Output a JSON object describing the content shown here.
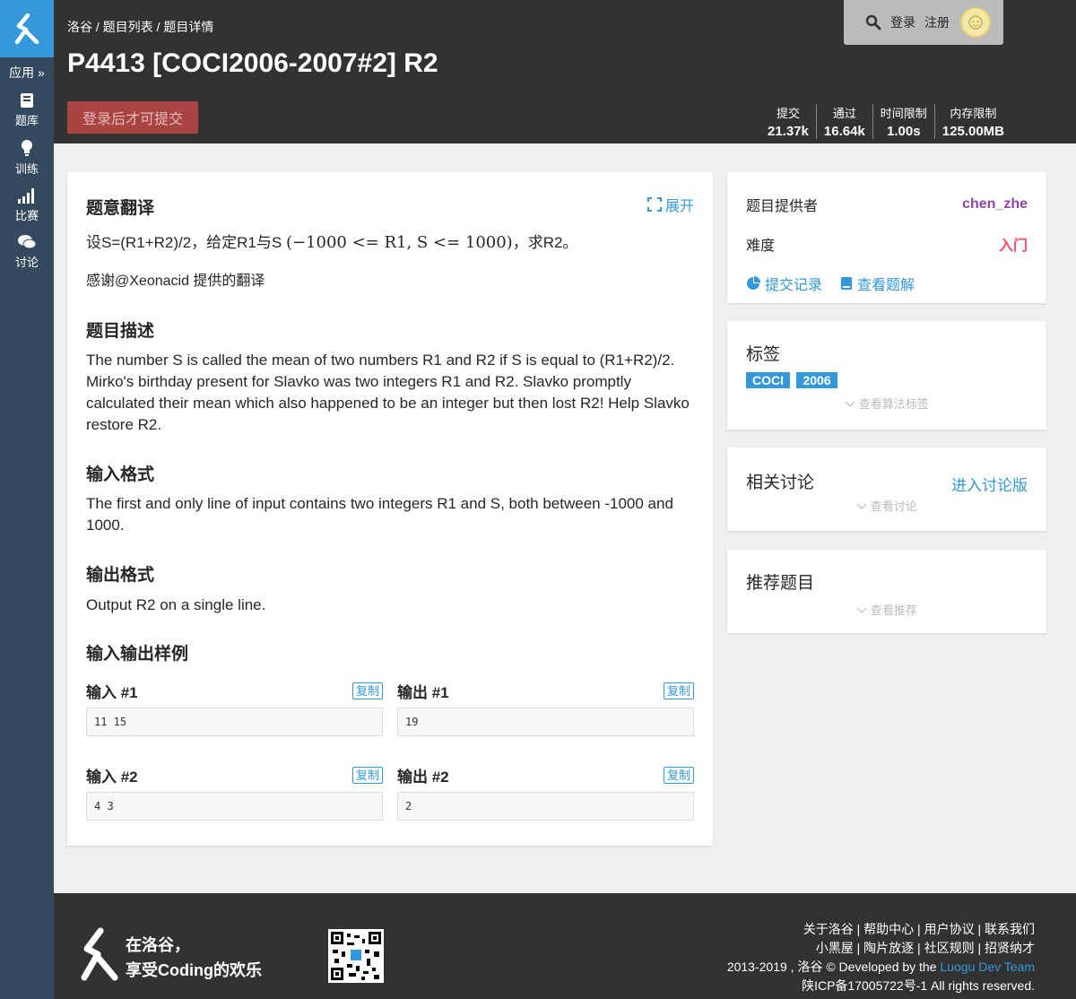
{
  "sidebar": {
    "apps_label": "应用 »",
    "items": [
      {
        "label": "题库",
        "icon": "book-icon"
      },
      {
        "label": "训练",
        "icon": "lightbulb-icon"
      },
      {
        "label": "比赛",
        "icon": "signal-bars-icon"
      },
      {
        "label": "讨论",
        "icon": "comments-icon"
      }
    ]
  },
  "header": {
    "breadcrumb": "洛谷 / 题目列表 / 题目详情",
    "title": "P4413 [COCI2006-2007#2] R2",
    "submit_label": "登录后才可提交",
    "login": "登录",
    "register": "注册",
    "stats": [
      {
        "key": "提交",
        "value": "21.37k"
      },
      {
        "key": "通过",
        "value": "16.64k"
      },
      {
        "key": "时间限制",
        "value": "1.00s"
      },
      {
        "key": "内存限制",
        "value": "125.00MB"
      }
    ]
  },
  "main": {
    "translation_heading": "题意翻译",
    "expand_label": "展开",
    "translation_prefix": "设S=(R1+R2)/2，给定R1与S ",
    "translation_math": "(−1000 <= R1, S <= 1000)",
    "translation_suffix": "，求R2。",
    "thanks": "感谢@Xeonacid 提供的翻译",
    "desc_heading": "题目描述",
    "desc_text": "The number S is called the mean of two numbers R1 and R2 if S is equal to (R1+R2)/2. Mirko's birthday present for Slavko was two integers R1 and R2. Slavko promptly calculated their mean which also happened to be an integer but then lost R2! Help Slavko restore R2.",
    "input_heading": "输入格式",
    "input_text": "The first and only line of input contains two integers R1 and S, both between -1000 and 1000.",
    "output_heading": "输出格式",
    "output_text": "Output R2 on a single line.",
    "samples_heading": "输入输出样例",
    "copy_label": "复制",
    "samples": [
      {
        "in_label": "输入 #1",
        "in": "11 15",
        "out_label": "输出 #1",
        "out": "19"
      },
      {
        "in_label": "输入 #2",
        "in": "4 3",
        "out_label": "输出 #2",
        "out": "2"
      }
    ]
  },
  "info": {
    "provider_label": "题目提供者",
    "provider": "chen_zhe",
    "provider_color": "#8e44ad",
    "difficulty_label": "难度",
    "difficulty": "入门",
    "difficulty_color": "#fe4c61",
    "records_link": "提交记录",
    "solutions_link": "查看题解"
  },
  "tags": {
    "title": "标签",
    "items": [
      "COCI",
      "2006"
    ],
    "show_label": "查看算法标签"
  },
  "discuss": {
    "title": "相关讨论",
    "enter_link": "进入讨论版",
    "show_label": "查看讨论"
  },
  "recommend": {
    "title": "推荐题目",
    "show_label": "查看推荐"
  },
  "footer": {
    "slogan_1": "在洛谷，",
    "slogan_2": "享受Coding的欢乐",
    "links_1": "关于洛谷 | 帮助中心 | 用户协议 | 联系我们",
    "links_2": "小黑屋 | 陶片放逐 | 社区规则 | 招贤纳才",
    "copyright": "2013-2019 , 洛谷 © Developed by the ",
    "dev_team": "Luogu Dev Team",
    "icp": "陕ICP备17005722号-1 All rights reserved."
  }
}
